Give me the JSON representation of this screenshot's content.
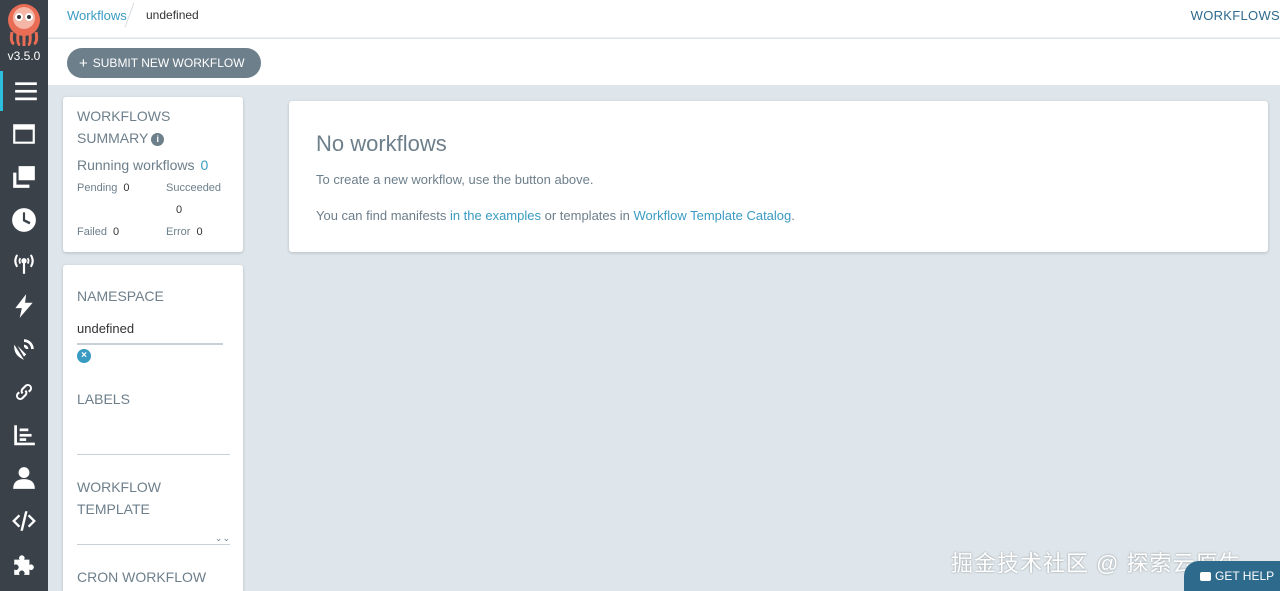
{
  "app": {
    "version": "v3.5.0"
  },
  "nav": {
    "items": [
      {
        "icon": "hamburger-icon",
        "label": "Workflows",
        "active": true
      },
      {
        "icon": "window-icon",
        "label": "Workflow Templates"
      },
      {
        "icon": "clone-icon",
        "label": "Cluster Workflow Templates"
      },
      {
        "icon": "clock-icon",
        "label": "Cron Workflows"
      },
      {
        "icon": "broadcast-icon",
        "label": "Event Sources"
      },
      {
        "icon": "bolt-icon",
        "label": "Sensors"
      },
      {
        "icon": "satellite-dish-icon",
        "label": "Event Flow"
      },
      {
        "icon": "link-icon",
        "label": "Archived Workflows"
      },
      {
        "icon": "chart-bar-icon",
        "label": "Reports"
      },
      {
        "icon": "user-icon",
        "label": "User"
      },
      {
        "icon": "code-icon",
        "label": "API Docs"
      },
      {
        "icon": "puzzle-icon",
        "label": "Plugins"
      }
    ]
  },
  "breadcrumb": {
    "link": "Workflows",
    "current": "undefined"
  },
  "header": {
    "title": "WORKFLOWS"
  },
  "toolbar": {
    "submit_label": "SUBMIT NEW WORKFLOW"
  },
  "summary": {
    "title_line1": "WORKFLOWS",
    "title_line2": "SUMMARY",
    "running_label": "Running workflows",
    "running_count": "0",
    "pending_label": "Pending",
    "pending_count": "0",
    "succeeded_label": "Succeeded",
    "succeeded_count": "0",
    "failed_label": "Failed",
    "failed_count": "0",
    "error_label": "Error",
    "error_count": "0"
  },
  "filters": {
    "namespace_label": "NAMESPACE",
    "namespace_value": "undefined",
    "labels_label": "LABELS",
    "template_label_line1": "WORKFLOW",
    "template_label_line2": "TEMPLATE",
    "cron_label": "CRON WORKFLOW"
  },
  "main": {
    "title": "No workflows",
    "line1": "To create a new workflow, use the button above.",
    "line2_pre": "You can find manifests ",
    "line2_link1": "in the examples",
    "line2_mid": " or templates in ",
    "line2_link2": "Workflow Template Catalog",
    "line2_post": "."
  },
  "watermark": "掘金技术社区 @ 探索云原生",
  "help": {
    "label": "GET HELP"
  },
  "colors": {
    "nav_bg": "#3a4149",
    "accent": "#3a9bc2",
    "content_bg": "#dee6eb",
    "button_bg": "#6d7f8b"
  }
}
